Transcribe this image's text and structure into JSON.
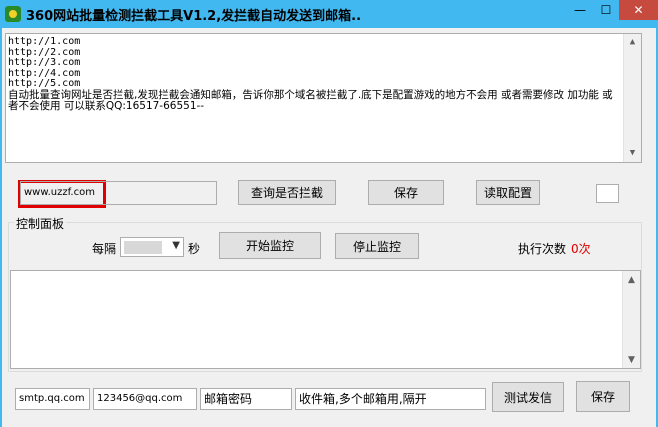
{
  "window": {
    "title": "360网站批量检测拦截工具V1.2,发拦截自动发送到邮箱..",
    "min_glyph": "—",
    "max_glyph": "☐",
    "close_glyph": "✕"
  },
  "url_list": {
    "lines": [
      "http://1.com",
      "http://2.com",
      "http://3.com",
      "http://4.com",
      "http://5.com"
    ],
    "note": "自动批量查询网址是否拦截,发现拦截会通知邮箱，告诉你那个域名被拦截了.底下是配置游戏的地方不会用 或者需要修改 加功能 或者不会使用 可以联系QQ:16517-66551--"
  },
  "query": {
    "domain_value": "www.uzzf.com",
    "check_button": "查询是否拦截",
    "save_button": "保存",
    "read_config_button": "读取配置"
  },
  "control_panel": {
    "title": "控制面板",
    "interval_label": "每隔",
    "seconds_label": "秒",
    "start_button": "开始监控",
    "stop_button": "停止监控",
    "exec_count_label": "执行次数",
    "exec_count_value": "0次",
    "exec_count_color": "#e00000"
  },
  "email": {
    "smtp_value": "smtp.qq.com",
    "account_value": "123456@qq.com",
    "password_value": "邮箱密码",
    "recipients_value": "收件箱,多个邮箱用,隔开",
    "test_button": "测试发信",
    "save_button": "保存"
  },
  "colors": {
    "titlebar": "#42b8f0",
    "close_button": "#c74a3e",
    "highlight_frame": "#e00000"
  },
  "icons": {
    "app": "app-icon",
    "minimize": "minimize-icon",
    "maximize": "maximize-icon",
    "close": "close-icon",
    "scroll_up": "scroll-up-icon",
    "scroll_down": "scroll-down-icon",
    "dropdown": "chevron-down-icon"
  }
}
